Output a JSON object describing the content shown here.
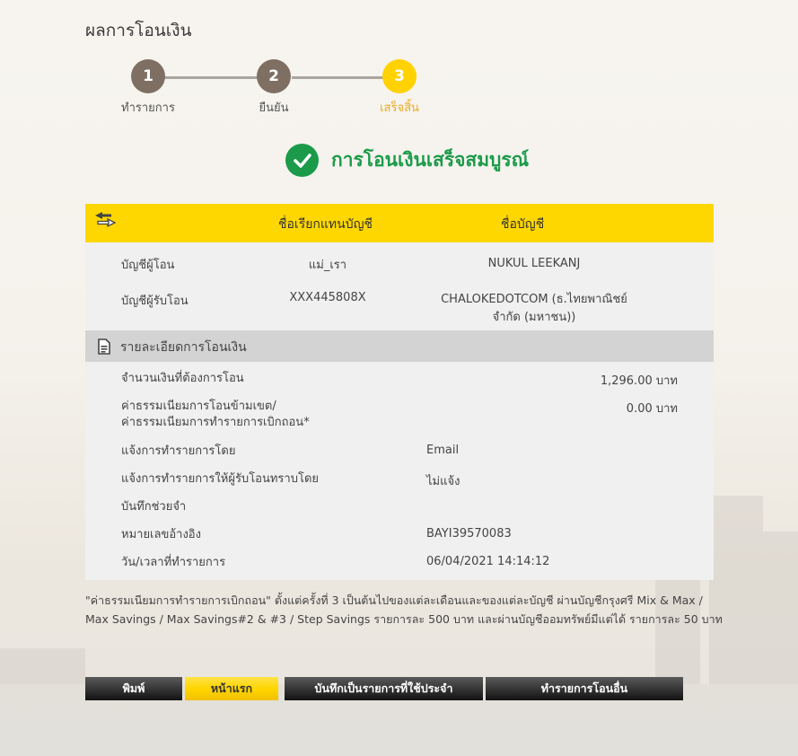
{
  "page": {
    "title": "ผลการโอนเงิน"
  },
  "stepper": {
    "steps": [
      {
        "number": "1",
        "label": "ทำรายการ",
        "state": "done"
      },
      {
        "number": "2",
        "label": "ยืนยัน",
        "state": "done"
      },
      {
        "number": "3",
        "label": "เสร็จสิ้น",
        "state": "active"
      }
    ]
  },
  "status": {
    "message": "การโอนเงินเสร็จสมบูรณ์",
    "icon": "check-circle-icon",
    "color": "#1b9b4a"
  },
  "accounts_table": {
    "header_icon": "transfer-arrows-icon",
    "col_nickname": "ชื่อเรียกแทนบัญชี",
    "col_account_name": "ชื่อบัญชี",
    "rows": [
      {
        "label": "บัญชีผู้โอน",
        "nickname": "แม่_เรา",
        "account_name_line1": "NUKUL LEEKANJ",
        "account_name_line2": ""
      },
      {
        "label": "บัญชีผู้รับโอน",
        "nickname": "XXX445808X",
        "account_name_line1": "CHALOKEDOTCOM (ธ.ไทยพาณิชย์",
        "account_name_line2": "จำกัด (มหาชน))"
      }
    ]
  },
  "details": {
    "section_title": "รายละเอียดการโอนเงิน",
    "section_icon": "document-icon",
    "amount_label": "จำนวนเงินที่ต้องการโอน",
    "amount_value": "1,296.00 บาท",
    "fee_label_line1": "ค่าธรรมเนียมการโอนข้ามเขต/",
    "fee_label_line2": "ค่าธรรมเนียมการทำรายการเบิกถอน*",
    "fee_value": "0.00 บาท",
    "notify_label": "แจ้งการทำรายการโดย",
    "notify_value": "Email",
    "notify_recipient_label": "แจ้งการทำรายการให้ผู้รับโอนทราบโดย",
    "notify_recipient_value": "ไม่แจ้ง",
    "memo_label": "บันทึกช่วยจำ",
    "memo_value": "",
    "reference_label": "หมายเลขอ้างอิง",
    "reference_value": "BAYI39570083",
    "datetime_label": "วัน/เวลาที่ทำรายการ",
    "datetime_value": "06/04/2021 14:14:12"
  },
  "footnote": {
    "line1": "\"ค่าธรรมเนียมการทำรายการเบิกถอน\" ตั้งแต่ครั้งที่ 3 เป็นต้นไปของแต่ละเดือนและของแต่ละบัญชี ผ่านบัญชีกรุงศรี Mix & Max /",
    "line2": "Max Savings / Max Savings#2 & #3 / Step Savings รายการละ 500 บาท และผ่านบัญชีออมทรัพย์มีแต่ได้ รายการละ 50 บาท"
  },
  "buttons": {
    "print": "พิมพ์",
    "home": "หน้าแรก",
    "save_favorite": "บันทึกเป็นรายการที่ใช้ประจำ",
    "new_transfer": "ทำรายการโอนอื่น"
  },
  "colors": {
    "brand_yellow": "#ffd700",
    "step_done": "#7f6f63",
    "step_active": "#ffd200",
    "active_label": "#e8ad2a"
  }
}
